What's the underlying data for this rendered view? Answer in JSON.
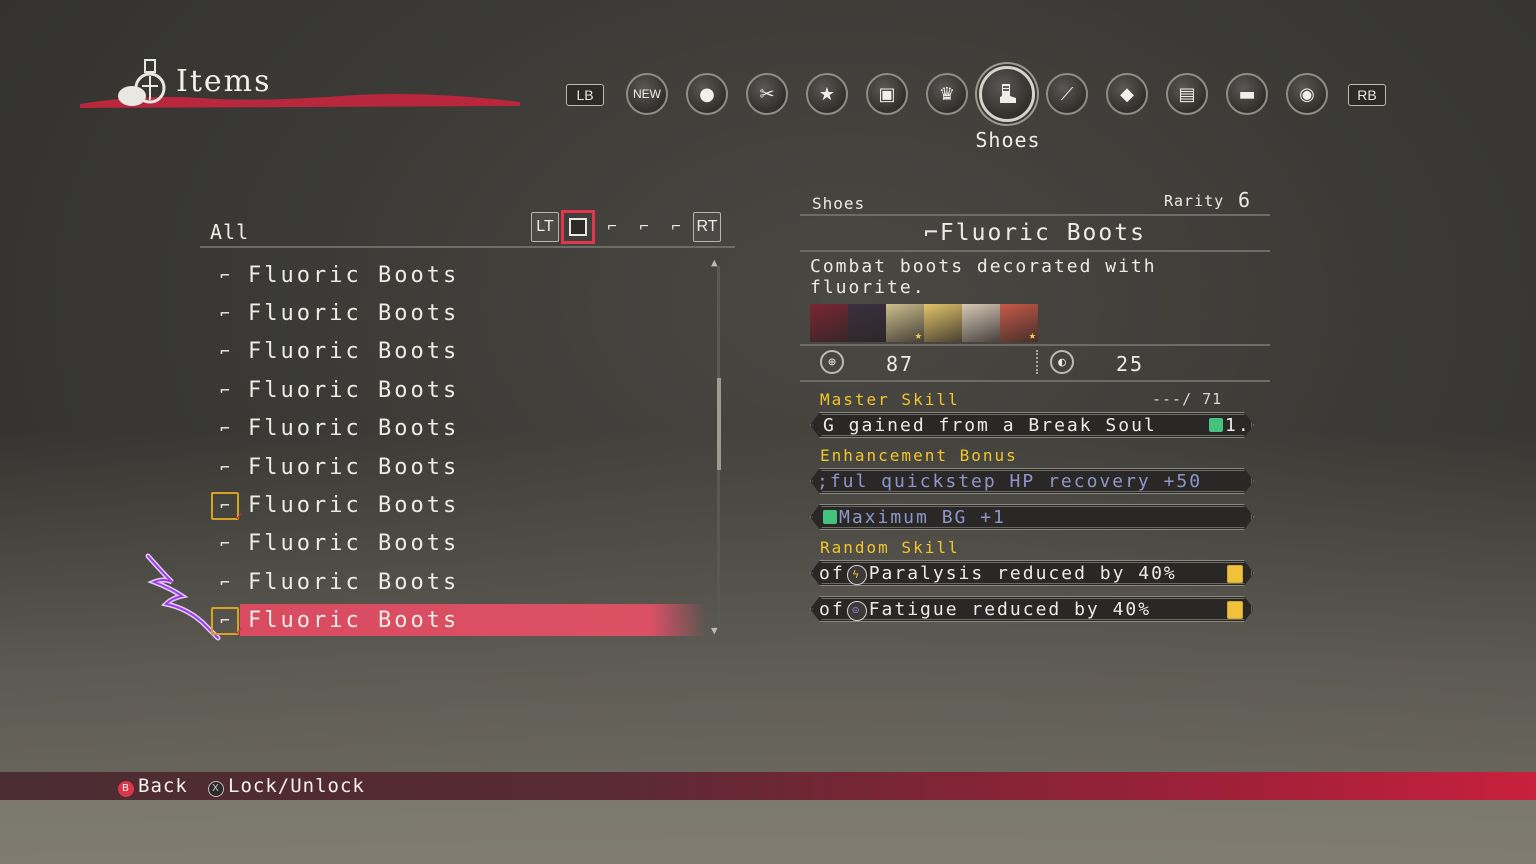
{
  "header": {
    "title": "Items",
    "lb_label": "LB",
    "rb_label": "RB",
    "selected_category": "Shoes",
    "categories": [
      {
        "name": "new-icon",
        "glyph": "NEW"
      },
      {
        "name": "gel-icon",
        "glyph": "●"
      },
      {
        "name": "weapon-icon",
        "glyph": "✂"
      },
      {
        "name": "star-icon",
        "glyph": "★"
      },
      {
        "name": "armor-icon",
        "glyph": "▣"
      },
      {
        "name": "accessory-icon",
        "glyph": "♛"
      },
      {
        "name": "shoes-icon",
        "glyph": "⌐"
      },
      {
        "name": "feather-icon",
        "glyph": "⟋"
      },
      {
        "name": "crystal-icon",
        "glyph": "◆"
      },
      {
        "name": "chest-icon",
        "glyph": "▤"
      },
      {
        "name": "hat-icon",
        "glyph": "▬"
      },
      {
        "name": "signal-icon",
        "glyph": "◉"
      }
    ]
  },
  "list": {
    "filter_label": "All",
    "lt_label": "LT",
    "rt_label": "RT",
    "items": [
      {
        "name": "Fluoric Boots",
        "equipped": false
      },
      {
        "name": "Fluoric Boots",
        "equipped": false
      },
      {
        "name": "Fluoric Boots",
        "equipped": false
      },
      {
        "name": "Fluoric Boots",
        "equipped": false
      },
      {
        "name": "Fluoric Boots",
        "equipped": false
      },
      {
        "name": "Fluoric Boots",
        "equipped": false
      },
      {
        "name": "Fluoric Boots",
        "equipped": true
      },
      {
        "name": "Fluoric Boots",
        "equipped": false
      },
      {
        "name": "Fluoric Boots",
        "equipped": false
      },
      {
        "name": "Fluoric Boots",
        "equipped": true,
        "selected": true
      }
    ]
  },
  "detail": {
    "category": "Shoes",
    "rarity_label": "Rarity",
    "rarity": "6",
    "name": "Fluoric Boots",
    "description": "Combat boots decorated with fluorite.",
    "portraits": [
      {
        "name": "portrait-1",
        "star": false,
        "color": "#7a2634"
      },
      {
        "name": "portrait-2",
        "star": false,
        "color": "#3b2f3e"
      },
      {
        "name": "portrait-3",
        "star": true,
        "color": "#cdbf8e"
      },
      {
        "name": "portrait-4",
        "star": false,
        "color": "#e3c46a"
      },
      {
        "name": "portrait-5",
        "star": false,
        "color": "#d8c9b7"
      },
      {
        "name": "portrait-6",
        "star": true,
        "color": "#c85a48"
      }
    ],
    "stat1": "87",
    "stat2": "25",
    "master_skill_label": "Master Skill",
    "mastery": "---/ 71",
    "master_skill": "G gained from a Break Soul",
    "master_skill_end": "1.",
    "enhancement_label": "Enhancement Bonus",
    "enhancement_1": ";ful quickstep HP recovery +50",
    "enhancement_2": "Maximum BG +1",
    "random_skill_label": "Random Skill",
    "random_1_prefix": "of",
    "random_1": "Paralysis reduced by 40%",
    "random_2_prefix": "of",
    "random_2": "Fatigue reduced by 40%"
  },
  "footer": {
    "back_btn": "B",
    "back_label": "Back",
    "lock_btn": "X",
    "lock_label": "Lock/Unlock"
  },
  "colors": {
    "accent_red": "#dc5065",
    "skill_yellow": "#f3c52b",
    "equip_gold": "#d9a321",
    "dim_text": "#8e96c8"
  }
}
